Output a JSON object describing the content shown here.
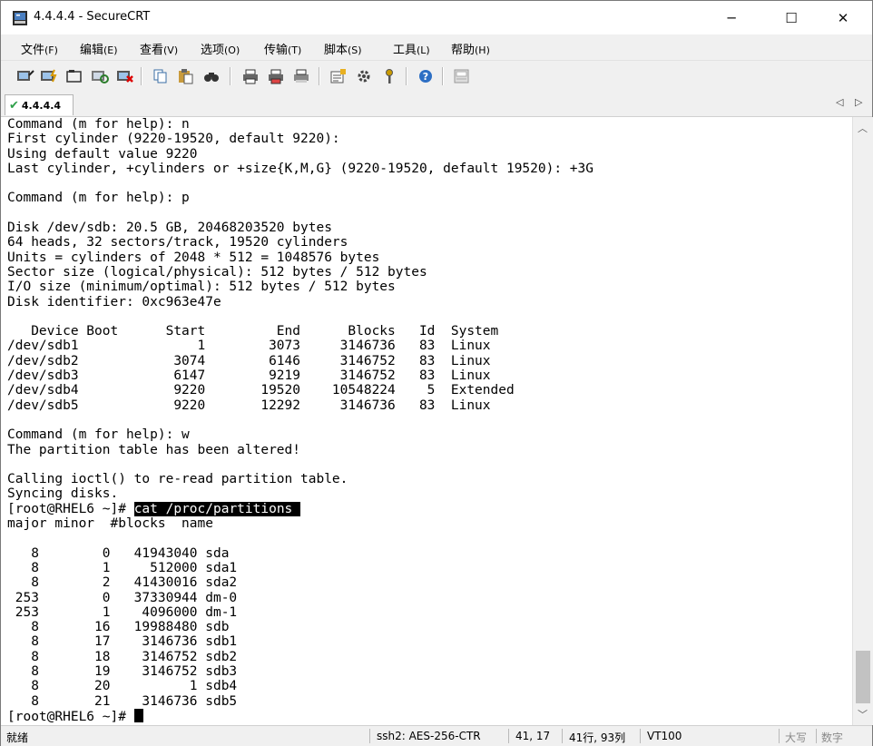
{
  "window": {
    "title": "4.4.4.4 - SecureCRT",
    "minimize": "─",
    "maximize": "☐",
    "close": "✕"
  },
  "menu": [
    {
      "label": "文件",
      "accel": "(F)"
    },
    {
      "label": "编辑",
      "accel": "(E)"
    },
    {
      "label": "查看",
      "accel": "(V)"
    },
    {
      "label": "选项",
      "accel": "(O)"
    },
    {
      "label": "传输",
      "accel": "(T)"
    },
    {
      "label": "脚本",
      "accel": "(S)"
    },
    {
      "label": "工具",
      "accel": "(L)"
    },
    {
      "label": "帮助",
      "accel": "(H)"
    }
  ],
  "toolbar_icons": [
    "connect-icon",
    "quick-connect-icon",
    "connect-tab-icon",
    "reconnect-icon",
    "disconnect-icon",
    "copy-icon",
    "paste-icon",
    "find-icon",
    "print-icon",
    "print-selection-icon",
    "print-setup-icon",
    "session-options-icon",
    "global-options-icon",
    "key-icon",
    "help-icon",
    "keymap-icon"
  ],
  "tab": {
    "label": "4.4.4.4",
    "status": "connected"
  },
  "terminal": {
    "lines_before": [
      "Command (m for help): n",
      "First cylinder (9220-19520, default 9220):",
      "Using default value 9220",
      "Last cylinder, +cylinders or +size{K,M,G} (9220-19520, default 19520): +3G",
      "",
      "Command (m for help): p",
      "",
      "Disk /dev/sdb: 20.5 GB, 20468203520 bytes",
      "64 heads, 32 sectors/track, 19520 cylinders",
      "Units = cylinders of 2048 * 512 = 1048576 bytes",
      "Sector size (logical/physical): 512 bytes / 512 bytes",
      "I/O size (minimum/optimal): 512 bytes / 512 bytes",
      "Disk identifier: 0xc963e47e",
      "",
      "   Device Boot      Start         End      Blocks   Id  System",
      "/dev/sdb1               1        3073     3146736   83  Linux",
      "/dev/sdb2            3074        6146     3146752   83  Linux",
      "/dev/sdb3            6147        9219     3146752   83  Linux",
      "/dev/sdb4            9220       19520    10548224    5  Extended",
      "/dev/sdb5            9220       12292     3146736   83  Linux",
      "",
      "Command (m for help): w",
      "The partition table has been altered!",
      "",
      "Calling ioctl() to re-read partition table.",
      "Syncing disks."
    ],
    "prompt1": "[root@RHEL6 ~]# ",
    "command1": "cat /proc/partitions ",
    "lines_after": [
      "major minor  #blocks  name",
      "",
      "   8        0   41943040 sda",
      "   8        1     512000 sda1",
      "   8        2   41430016 sda2",
      " 253        0   37330944 dm-0",
      " 253        1    4096000 dm-1",
      "   8       16   19988480 sdb",
      "   8       17    3146736 sdb1",
      "   8       18    3146752 sdb2",
      "   8       19    3146752 sdb3",
      "   8       20          1 sdb4",
      "   8       21    3146736 sdb5"
    ],
    "prompt2": "[root@RHEL6 ~]# "
  },
  "status": {
    "ready": "就绪",
    "cipher": "ssh2: AES-256-CTR",
    "position": "41,  17",
    "size": "41行, 93列",
    "emulation": "VT100",
    "caps": "大写",
    "num": "数字"
  }
}
